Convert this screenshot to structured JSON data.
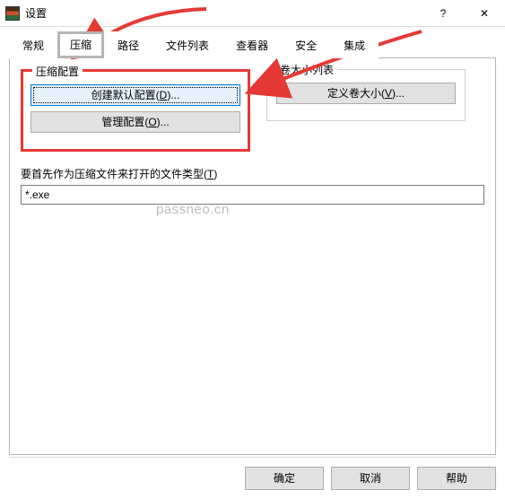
{
  "window": {
    "title": "设置",
    "help_glyph": "?",
    "close_glyph": "✕"
  },
  "tabs": {
    "items": [
      {
        "label": "常规"
      },
      {
        "label": "压缩"
      },
      {
        "label": "路径"
      },
      {
        "label": "文件列表"
      },
      {
        "label": "查看器"
      },
      {
        "label": "安全"
      },
      {
        "label": "集成"
      }
    ],
    "active_index": 1
  },
  "group_left": {
    "legend": "压缩配置",
    "btn_create": {
      "pre": "创建默认配置(",
      "key": "D",
      "post": ")..."
    },
    "btn_manage": {
      "pre": "管理配置(",
      "key": "O",
      "post": ")..."
    }
  },
  "group_right": {
    "legend": "卷大小列表",
    "btn_define": {
      "pre": "定义卷大小(",
      "key": "V",
      "post": ")..."
    }
  },
  "filetype": {
    "label_pre": "要首先作为压缩文件来打开的文件类型(",
    "label_key": "T",
    "label_post": ")",
    "value": "*.exe"
  },
  "watermark": "passneo.cn",
  "footer": {
    "ok": "确定",
    "cancel": "取消",
    "help": "帮助"
  }
}
